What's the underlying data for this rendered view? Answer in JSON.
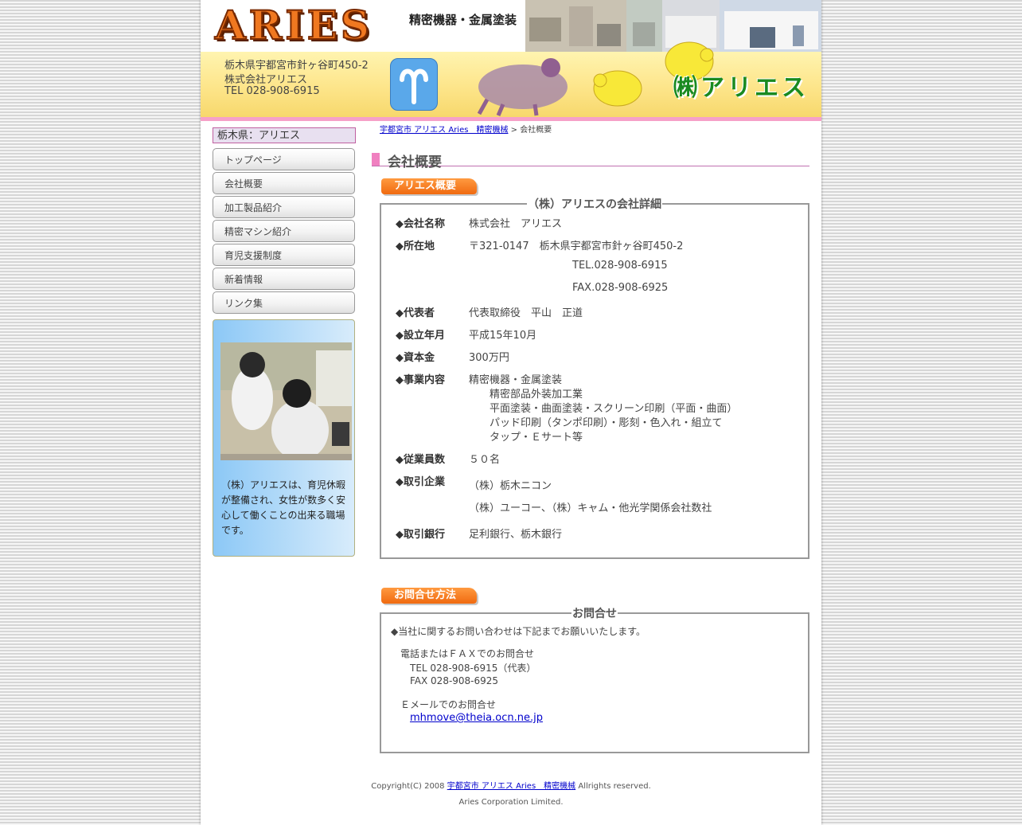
{
  "header": {
    "logo": "ARIES",
    "tagline": "精密機器・金属塗装",
    "address_lines": [
      "栃木県宇都宮市針ヶ谷町450-2",
      "株式会社アリエス",
      "TEL 028-908-6915"
    ],
    "title": "㈱アリエス"
  },
  "sidebar": {
    "region": "栃木県：アリエス",
    "nav": [
      "トップページ",
      "会社概要",
      "加工製品紹介",
      "精密マシン紹介",
      "育児支援制度",
      "新着情報",
      "リンク集"
    ],
    "promo_text": "（株）アリエスは、育児休暇が整備され、女性が数多く安心して働くことの出来る職場です。"
  },
  "breadcrumb": {
    "home_link": "宇都宮市 アリエス Aries　精密機械",
    "separator": " > ",
    "current": "会社概要"
  },
  "main": {
    "heading": "会社概要",
    "overview": {
      "tab": "アリエス概要",
      "legend": "（株）アリエスの会社詳細",
      "rows": [
        {
          "label": "◆会社名称",
          "lines": [
            "株式会社　アリエス"
          ]
        },
        {
          "label": "◆所在地",
          "lines": [
            "〒321-0147　栃木県宇都宮市針ヶ谷町450-2",
            "TEL.028-908-6915",
            "FAX.028-908-6925"
          ]
        },
        {
          "label": "◆代表者",
          "lines": [
            "代表取締役　平山　正道"
          ]
        },
        {
          "label": "◆設立年月",
          "lines": [
            "平成15年10月"
          ]
        },
        {
          "label": "◆資本金",
          "lines": [
            "300万円"
          ]
        },
        {
          "label": "◆事業内容",
          "lines": [
            "精密機器・金属塗装",
            "精密部品外装加工業",
            "平面塗装・曲面塗装・スクリーン印刷（平面・曲面）",
            "パッド印刷（タンポ印刷）・彫刻・色入れ・組立て",
            "タップ・Ｅサート等"
          ]
        },
        {
          "label": "◆従業員数",
          "lines": [
            "５０名"
          ]
        },
        {
          "label": "◆取引企業",
          "lines": [
            "（株）栃木ニコン",
            "（株）ユーコー、（株）キャム・他光学関係会社数社"
          ]
        },
        {
          "label": "◆取引銀行",
          "lines": [
            "足利銀行、栃木銀行"
          ]
        }
      ]
    },
    "contact": {
      "tab": "お問合せ方法",
      "legend": "お問合せ",
      "intro": "◆当社に関するお問い合わせは下記までお願いいたします。",
      "phone_heading": "電話またはＦＡＸでのお問合せ",
      "tel": "TEL 028-908-6915（代表）",
      "fax": "FAX 028-908-6925",
      "email_heading": "Ｅメールでのお問合せ",
      "email": "mhmove@theia.ocn.ne.jp"
    }
  },
  "footer": {
    "copyright_prefix": "Copyright(C) 2008 ",
    "link": "宇都宮市 アリエス Aries　精密機械",
    "suffix": " Allrights reserved.",
    "company": "Aries Corporation Limited."
  },
  "colors": {
    "accent_orange": "#f07820",
    "pink_rule": "#f080c0",
    "kabu_green": "#1a8a20"
  }
}
